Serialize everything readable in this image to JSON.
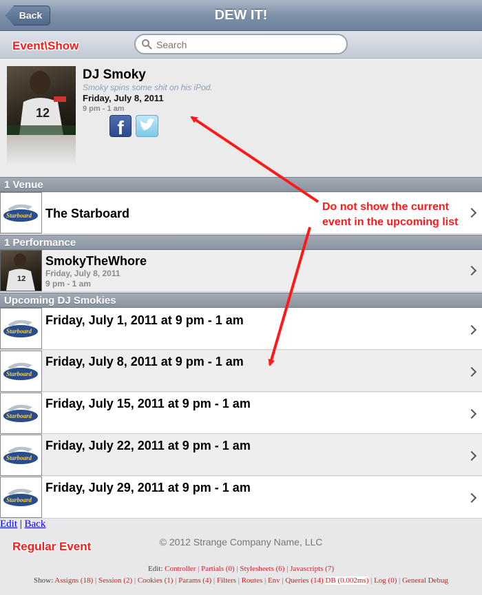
{
  "navbar": {
    "back_label": "Back",
    "title": "DEW IT!"
  },
  "search": {
    "placeholder": "Search"
  },
  "annotations": {
    "event_show": "Event\\Show",
    "note_line1": "Do not show the current",
    "note_line2": "event in the upcoming list",
    "regular_event": "Regular Event",
    "annotation_color": "#ff1a1a"
  },
  "event": {
    "title": "DJ Smoky",
    "description": "Smoky spins some shit on his iPod.",
    "date": "Friday, July 8, 2011",
    "time": "9 pm - 1 am",
    "share_icons": [
      "facebook-icon",
      "twitter-icon"
    ]
  },
  "sections": {
    "venue_header": "1 Venue",
    "performance_header": "1 Performance",
    "upcoming_header": "Upcoming DJ Smokies"
  },
  "venue": {
    "name": "The Starboard",
    "logo_text": "Starboard"
  },
  "performance": {
    "name": "SmokyTheWhore",
    "date": "Friday, July 8, 2011",
    "time": "9 pm - 1 am"
  },
  "upcoming": [
    {
      "label": "Friday, July 1, 2011 at 9 pm - 1 am"
    },
    {
      "label": "Friday, July 8, 2011 at 9 pm - 1 am"
    },
    {
      "label": "Friday, July 15, 2011 at 9 pm - 1 am"
    },
    {
      "label": "Friday, July 22, 2011 at 9 pm - 1 am"
    },
    {
      "label": "Friday, July 29, 2011 at 9 pm - 1 am"
    }
  ],
  "footer": {
    "edit_link": "Edit",
    "separator": "|",
    "back_link": "Back",
    "copyright": "© 2012 Strange Company Name, LLC"
  },
  "debug": {
    "edit_prefix": "Edit:",
    "edit_links": [
      "Controller",
      "Partials (0)",
      "Stylesheets (6)",
      "Javascripts (7)"
    ],
    "show_prefix": "Show:",
    "show_links": [
      "Assigns (18)",
      "Session (2)",
      "Cookies (1)",
      "Params (4)",
      "Filters",
      "Routes",
      "Env",
      "Queries (14)",
      "DB (0.002ms)",
      "Log (0)",
      "General Debug"
    ]
  }
}
